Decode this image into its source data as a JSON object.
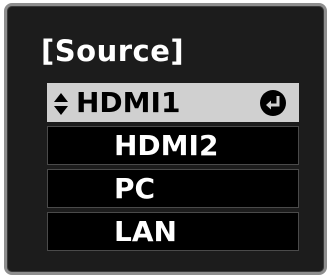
{
  "menu": {
    "title": "[Source]"
  },
  "sources": [
    {
      "label": "HDMI1",
      "selected": true
    },
    {
      "label": "HDMI2",
      "selected": false
    },
    {
      "label": "PC",
      "selected": false
    },
    {
      "label": "LAN",
      "selected": false
    }
  ],
  "colors": {
    "background": "#1c1c1c",
    "selected_row": "#d0d0d0",
    "row": "#000000",
    "text": "#ffffff"
  },
  "icons": {
    "navigation": "up-down-arrows-icon",
    "confirm": "enter-icon"
  }
}
